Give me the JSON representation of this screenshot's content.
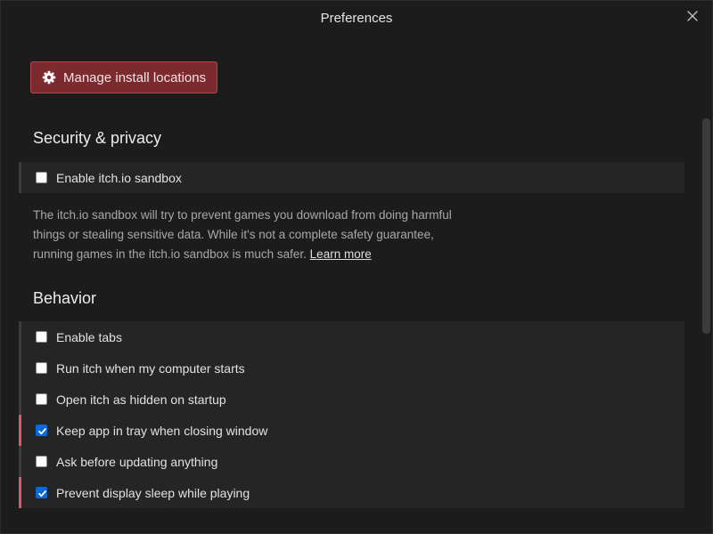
{
  "window": {
    "title": "Preferences",
    "close_icon": "close-icon"
  },
  "install": {
    "button_label": "Manage install locations",
    "icon": "gear-icon"
  },
  "security": {
    "heading": "Security & privacy",
    "sandbox": {
      "label": "Enable itch.io sandbox",
      "checked": false
    },
    "description": "The itch.io sandbox will try to prevent games you download from doing harmful things or stealing sensitive data. While it's not a complete safety guarantee, running games in the itch.io sandbox is much safer.",
    "learn_more": "Learn more"
  },
  "behavior": {
    "heading": "Behavior",
    "options": [
      {
        "label": "Enable tabs",
        "checked": false
      },
      {
        "label": "Run itch when my computer starts",
        "checked": false
      },
      {
        "label": "Open itch as hidden on startup",
        "checked": false
      },
      {
        "label": "Keep app in tray when closing window",
        "checked": true
      },
      {
        "label": "Ask before updating anything",
        "checked": false
      },
      {
        "label": "Prevent display sleep while playing",
        "checked": true
      }
    ]
  },
  "colors": {
    "accent": "#7d2a2f",
    "checked_marker": "#e1595e",
    "checkbox_on": "#0b6ad8"
  }
}
